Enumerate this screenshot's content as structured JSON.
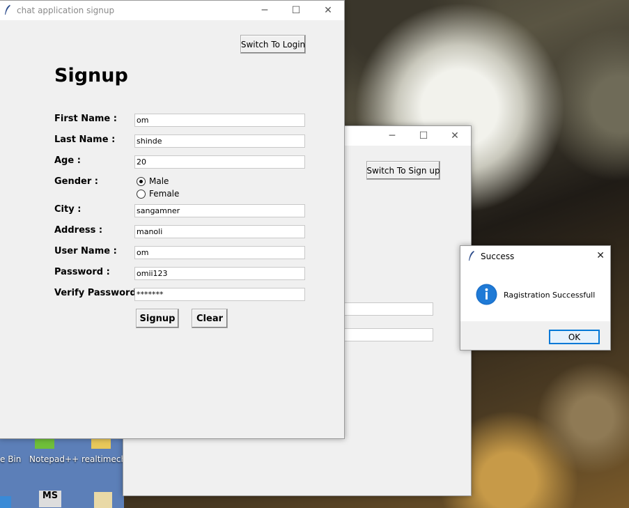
{
  "desktop": {
    "icons": [
      {
        "label": "e Bin"
      },
      {
        "label": "Notepad++"
      },
      {
        "label": "realtimech..."
      },
      {
        "label": "MS"
      }
    ]
  },
  "signup_window": {
    "title": "chat application signup",
    "switch_button": "Switch To Login",
    "heading": "Signup",
    "fields": {
      "first_name": {
        "label": "First Name :",
        "value": "om"
      },
      "last_name": {
        "label": "Last Name :",
        "value": "shinde"
      },
      "age": {
        "label": "Age :",
        "value": "20"
      },
      "gender": {
        "label": "Gender :",
        "options": [
          "Male",
          "Female"
        ],
        "selected": "Male"
      },
      "city": {
        "label": "City :",
        "value": "sangamner"
      },
      "address": {
        "label": "Address :",
        "value": "manoli"
      },
      "username": {
        "label": "User Name :",
        "value": "om"
      },
      "password": {
        "label": "Password :",
        "value": "omii123"
      },
      "verify_password": {
        "label": "Verify Password",
        "value": "*******"
      }
    },
    "signup_button": "Signup",
    "clear_button": "Clear"
  },
  "login_window": {
    "switch_button": "Switch To Sign up"
  },
  "success_dialog": {
    "title": "Success",
    "message": "Ragistration Successfull",
    "ok_button": "OK",
    "icon": "info-icon"
  },
  "window_controls": {
    "minimize": "─",
    "maximize": "☐",
    "close": "✕"
  }
}
